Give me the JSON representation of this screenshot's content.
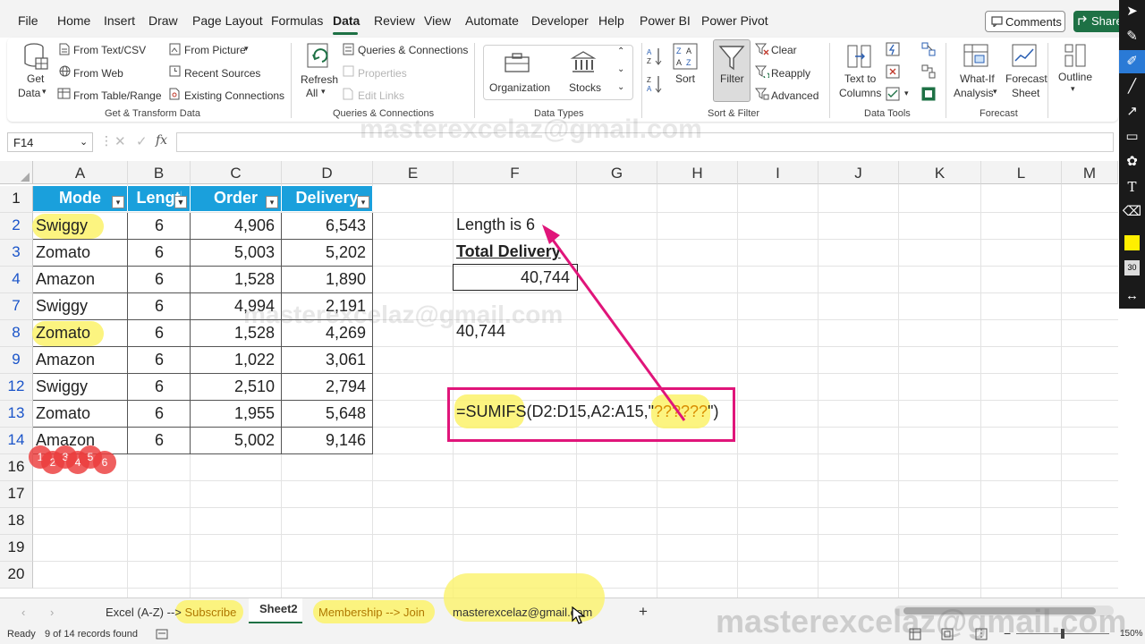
{
  "menu": {
    "items": [
      "File",
      "Home",
      "Insert",
      "Draw",
      "Page Layout",
      "Formulas",
      "Data",
      "Review",
      "View",
      "Automate",
      "Developer",
      "Help",
      "Power BI",
      "Power Pivot"
    ],
    "active": "Data",
    "comments": "Comments",
    "share": "Share"
  },
  "ribbon": {
    "get_transform": {
      "get_data": "Get",
      "get_data2": "Data",
      "from_text": "From Text/CSV",
      "from_web": "From Web",
      "from_table": "From Table/Range",
      "from_picture": "From Picture",
      "recent_sources": "Recent Sources",
      "existing_connections": "Existing Connections",
      "label": "Get & Transform Data"
    },
    "queries": {
      "refresh": "Refresh",
      "refresh2": "All",
      "queries_connections": "Queries & Connections",
      "properties": "Properties",
      "edit_links": "Edit Links",
      "label": "Queries & Connections"
    },
    "data_types": {
      "organization": "Organization",
      "stocks": "Stocks",
      "label": "Data Types"
    },
    "sort_filter": {
      "sort": "Sort",
      "filter": "Filter",
      "clear": "Clear",
      "reapply": "Reapply",
      "advanced": "Advanced",
      "label": "Sort & Filter"
    },
    "data_tools": {
      "text_to": "Text to",
      "columns": "Columns",
      "label": "Data Tools"
    },
    "forecast": {
      "what_if": "What-If",
      "analysis": "Analysis",
      "forecast": "Forecast",
      "sheet": "Sheet",
      "label": "Forecast"
    },
    "outline": {
      "label": "Outline"
    }
  },
  "formula_bar": {
    "name_box": "F14",
    "fx": "fx",
    "value": ""
  },
  "columns": [
    "A",
    "B",
    "C",
    "D",
    "E",
    "F",
    "G",
    "H",
    "I",
    "J",
    "K",
    "L",
    "M"
  ],
  "rows": [
    "1",
    "2",
    "3",
    "4",
    "7",
    "8",
    "9",
    "12",
    "13",
    "14",
    "16",
    "17",
    "18",
    "19",
    "20"
  ],
  "table": {
    "headers": [
      "Mode",
      "Length",
      "Order",
      "Delivery"
    ],
    "rows": [
      {
        "mode": "Swiggy",
        "length": "6",
        "order": "4,906",
        "delivery": "6,543"
      },
      {
        "mode": "Zomato",
        "length": "6",
        "order": "5,003",
        "delivery": "5,202"
      },
      {
        "mode": "Amazon",
        "length": "6",
        "order": "1,528",
        "delivery": "1,890"
      },
      {
        "mode": "Swiggy",
        "length": "6",
        "order": "4,994",
        "delivery": "2,191"
      },
      {
        "mode": "Zomato",
        "length": "6",
        "order": "1,528",
        "delivery": "4,269"
      },
      {
        "mode": "Amazon",
        "length": "6",
        "order": "1,022",
        "delivery": "3,061"
      },
      {
        "mode": "Swiggy",
        "length": "6",
        "order": "2,510",
        "delivery": "2,794"
      },
      {
        "mode": "Zomato",
        "length": "6",
        "order": "1,955",
        "delivery": "5,648"
      },
      {
        "mode": "Amazon",
        "length": "6",
        "order": "5,002",
        "delivery": "9,146"
      }
    ]
  },
  "side": {
    "length_note": "Length is 6",
    "total_label": "Total Delivery",
    "total_value": "40,744",
    "second_value": "40,744",
    "formula_prefix": "=SUMIFS",
    "formula_middle": "(D2:D15,A2:A15,\"",
    "formula_criteria": "??????",
    "formula_suffix": "\")"
  },
  "letter_counts": [
    "1",
    "2",
    "3",
    "4",
    "5",
    "6"
  ],
  "sheet_tabs": {
    "tab1_a": "Excel (A-Z) -->",
    "tab1_b": "Subscribe",
    "tab2": "Sheet2",
    "tab3": "Membership --> Join",
    "tab4": "masterexcelaz@gmail.com",
    "add": "+"
  },
  "status": {
    "ready": "Ready",
    "records": "9 of 14 records found",
    "zoom": "150%"
  },
  "watermark": "masterexcelaz@gmail.com",
  "colors": {
    "table_header": "#1aa0dc",
    "highlight": "#fbf26a",
    "annotation": "#e0157a",
    "excel_green": "#1e7145"
  }
}
